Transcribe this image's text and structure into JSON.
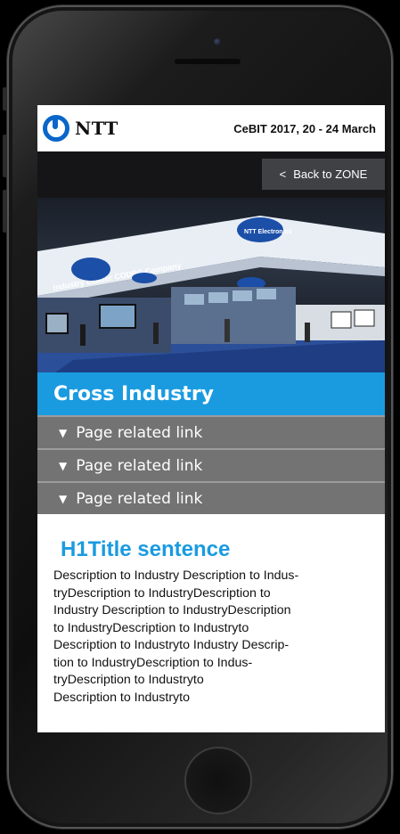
{
  "header": {
    "logo_text": "NTT",
    "event_text": "CeBIT 2017,  20 - 24 March"
  },
  "nav": {
    "back_label": "Back to ZONE",
    "back_icon": "chevron-left-icon"
  },
  "hero": {
    "booth_banner_text": "Industry Leader CODEC Company",
    "booth_logo_text": "NTT Electronics"
  },
  "section": {
    "title": "Cross Industry"
  },
  "links": [
    {
      "label": "Page related link"
    },
    {
      "label": "Page related link"
    },
    {
      "label": "Page related link"
    }
  ],
  "article": {
    "title": "H1Title sentence",
    "lines": [
      "Description to Industry Description to Indus-",
      "tryDescription to IndustryDescription to",
      "Industry Description to IndustryDescription",
      "to IndustryDescription to Industryto",
      "Description to Industryto Industry Descrip-",
      "tion to IndustryDescription to Indus-",
      "tryDescription to Industryto",
      "Description to Industryto"
    ]
  },
  "colors": {
    "accent": "#1a9be0",
    "brand_blue": "#0a66c9",
    "link_row_bg": "#737373",
    "back_button_bg": "#3f4145"
  }
}
